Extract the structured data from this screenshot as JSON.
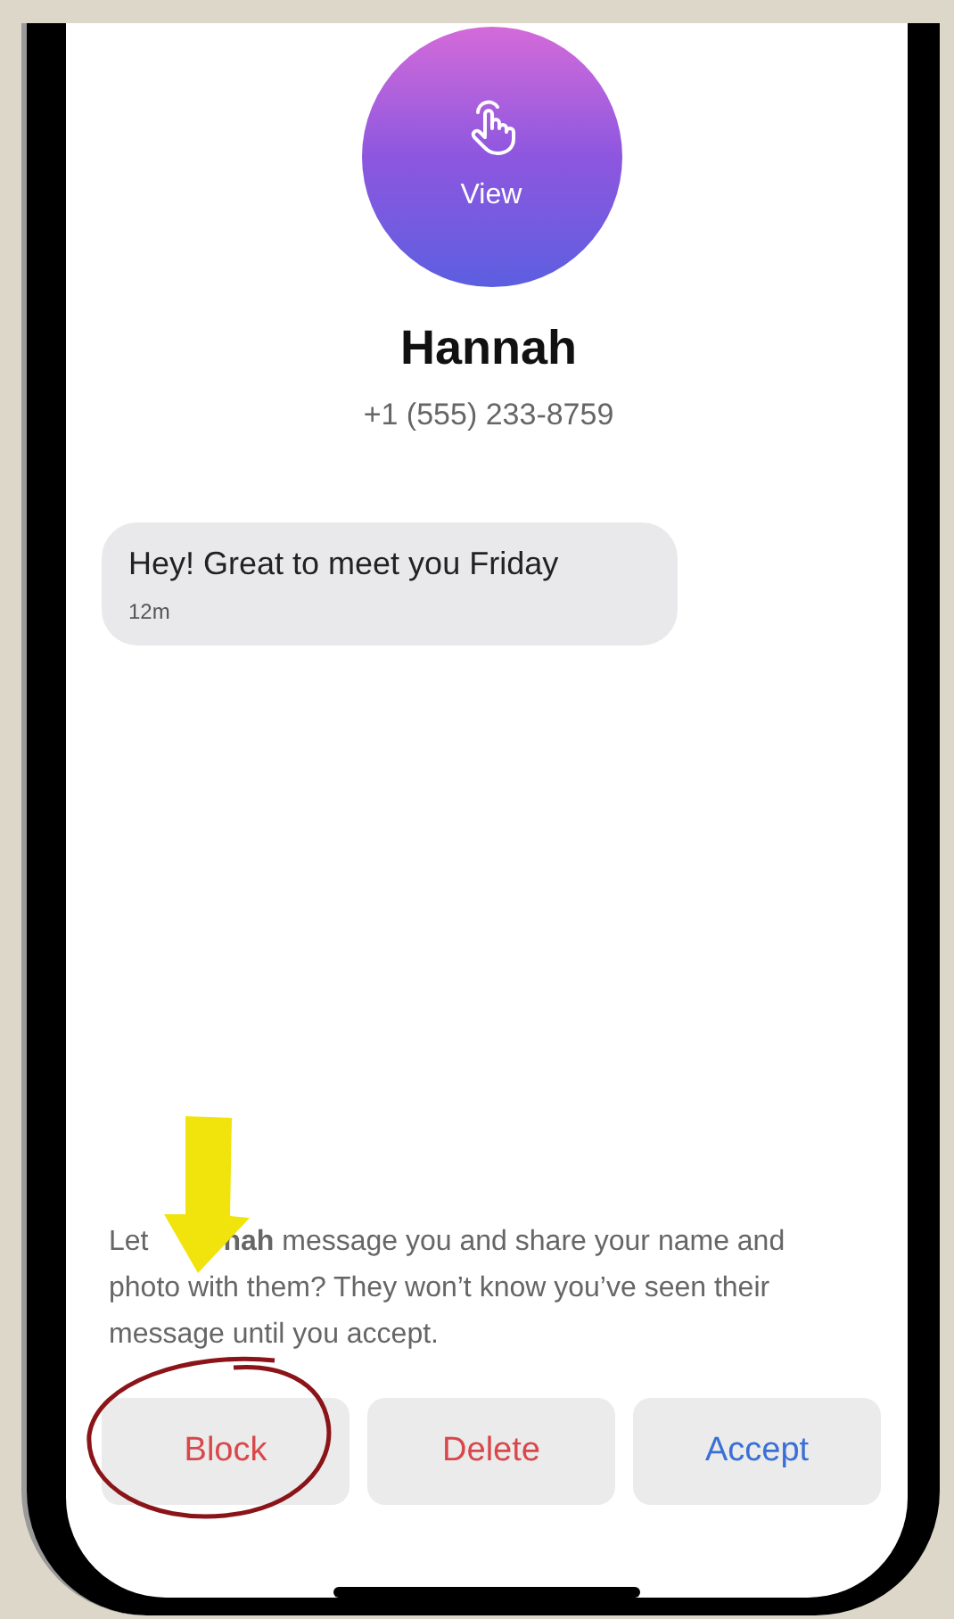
{
  "contact": {
    "avatar_label": "View",
    "name": "Hannah",
    "phone": "+1 (555) 233-8759"
  },
  "messages": [
    {
      "text": "Hey! Great to meet you Friday",
      "time": "12m"
    }
  ],
  "prompt_start": "Let",
  "prompt_rest": "**nah** message you and share your name and photo with them? They won’t know you’ve seen their message until you accept.",
  "actions": [
    {
      "label": "Block",
      "kind": "destructive"
    },
    {
      "label": "Delete",
      "kind": "destructive"
    },
    {
      "label": "Accept",
      "kind": "primary"
    }
  ]
}
